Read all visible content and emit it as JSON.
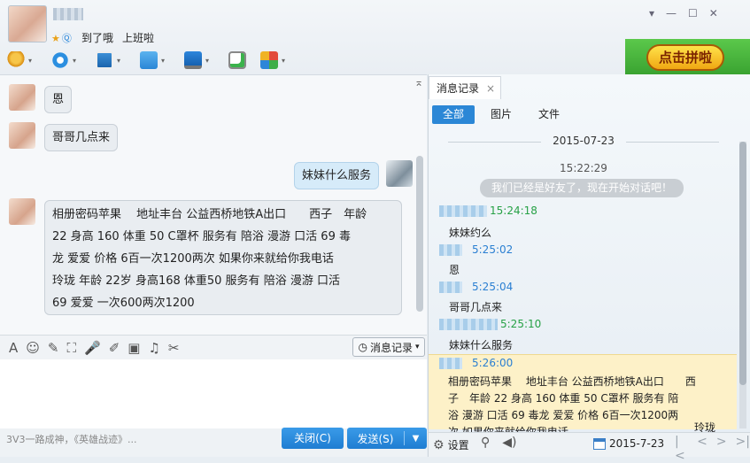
{
  "header": {
    "signature_words": [
      "到了哦",
      "上班啦"
    ],
    "status_star": "★",
    "status_qq": "Ⓠ"
  },
  "window_controls": [
    "▾",
    "—",
    "☐",
    "✕"
  ],
  "toolbar": {
    "icons": [
      "voice-call-icon",
      "video-call-icon",
      "screen-share-icon",
      "file-transfer-icon",
      "remote-desktop-icon",
      "add-app-icon",
      "apps-icon"
    ],
    "dropdown": "▾"
  },
  "ad": {
    "button_label": "点击拼啦"
  },
  "chat": {
    "collapse_glyph": "⌅",
    "messages": [
      {
        "from": "other",
        "text": "恩"
      },
      {
        "from": "other",
        "text": "哥哥几点来"
      },
      {
        "from": "me",
        "text": "妹妹什么服务"
      },
      {
        "from": "other",
        "lines": [
          "相册密码苹果　 地址丰台 公益西桥地铁A出口　　西子　年龄",
          "22  身高  160  体重  50  C罩杯  服务有  陪浴  漫游  口活  69  毒",
          "龙  爱爱  价格 6百一次1200两次  如果你来就给你我电话",
          "玲珑  年龄  22岁  身高168  体重50  服务有 陪浴 漫游  口活",
          "69  爱爱  一次600两次1200"
        ]
      }
    ]
  },
  "input_toolbar": {
    "icons": [
      "font-icon",
      "emoji-icon",
      "poke-icon",
      "screenshot-icon",
      "voice-message-icon",
      "edit-icon",
      "image-icon",
      "music-icon",
      "scissors-icon"
    ],
    "glyphs": [
      "A",
      "☺",
      "✎",
      "⛶",
      "🎤",
      "✐",
      "▣",
      "♫",
      "✂"
    ],
    "history_label": "消息记录"
  },
  "footer": {
    "ticker": "3V3一路成神，《英雄战迹》...",
    "close_label": "关闭(C)",
    "send_label": "发送(S)",
    "send_dropdown": "▼"
  },
  "history": {
    "tab_label": "消息记录",
    "tab_close": "×",
    "filters": [
      "全部",
      "图片",
      "文件"
    ],
    "date": "2015-07-23",
    "system_time": "15:22:29",
    "system_note": "我们已经是好友了，现在开始对话吧！",
    "entries": [
      {
        "time": "15:24:18",
        "color": "green",
        "text": "妹妹约么"
      },
      {
        "time": "5:25:02",
        "color": "blue",
        "text": "恩"
      },
      {
        "time": "5:25:04",
        "color": "blue",
        "text": "哥哥几点来"
      },
      {
        "time": "5:25:10",
        "color": "green",
        "text": "妹妹什么服务"
      },
      {
        "time": "5:26:00",
        "color": "blue",
        "text": ""
      }
    ],
    "highlight_lines": [
      "相册密码苹果　 地址丰台 公益西桥地铁A出口　　西",
      "子　年龄  22  身高  160  体重  50  C罩杯  服务有  陪",
      "浴  漫游  口活  69  毒龙  爱爱  价格 6百一次1200两",
      "次  如果你来就给你我电话"
    ],
    "highlight_extra": "玲珑",
    "settings_label": "设置",
    "calendar_date": "2015-7-23",
    "pager": [
      "|<",
      "<",
      ">",
      ">|"
    ]
  },
  "colors": {
    "accent": "#2b87d6",
    "highlight": "#fdf1c8",
    "time_green": "#27a146",
    "time_blue": "#2a7fd2"
  }
}
